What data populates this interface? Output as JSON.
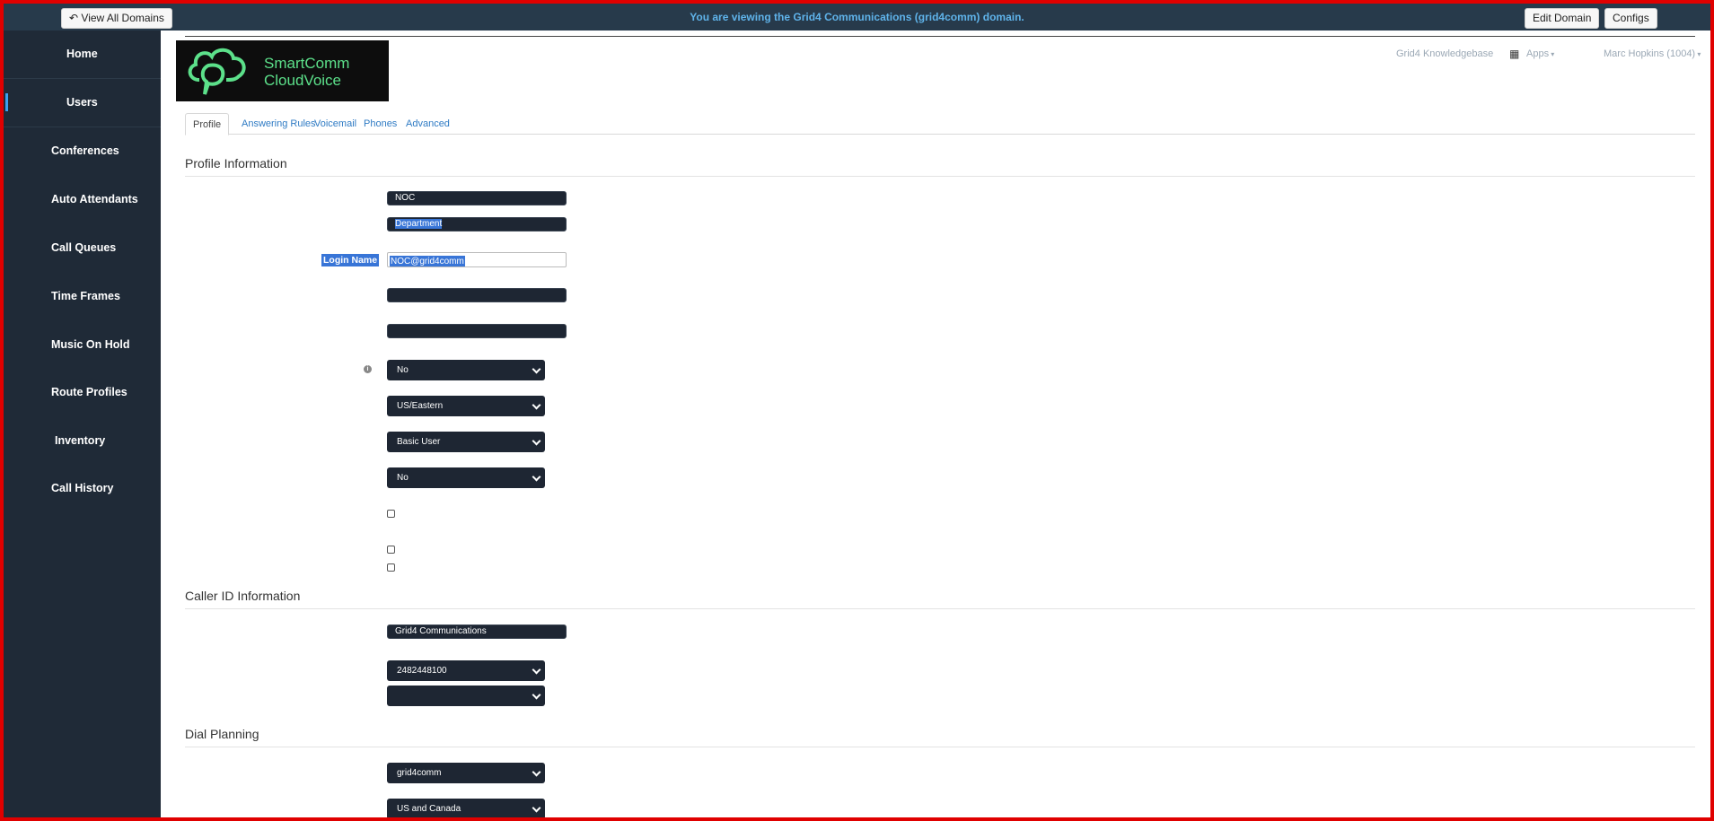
{
  "topbar": {
    "view_all_label": "View All Domains",
    "message": "You are viewing the Grid4 Communications (grid4comm) domain.",
    "edit_domain_label": "Edit Domain",
    "configs_label": "Configs"
  },
  "sidebar": {
    "items": [
      {
        "label": "Home"
      },
      {
        "label": "Users"
      },
      {
        "label": "Conferences"
      },
      {
        "label": "Auto Attendants"
      },
      {
        "label": "Call Queues"
      },
      {
        "label": "Time Frames"
      },
      {
        "label": "Music On Hold"
      },
      {
        "label": "Route Profiles"
      },
      {
        "label": "Inventory"
      },
      {
        "label": "Call History"
      }
    ]
  },
  "header": {
    "logo_line1": "SmartComm",
    "logo_line2": "CloudVoice",
    "knowledgebase": "Grid4 Knowledgebase",
    "apps": "Apps",
    "user": "Marc Hopkins (1004)"
  },
  "tabs": [
    "Profile",
    "Answering Rules",
    "Voicemail",
    "Phones",
    "Advanced"
  ],
  "profile": {
    "title": "Profile Information",
    "first_name": "NOC",
    "department": "Department",
    "login_label": "Login Name",
    "login_value": "NOC@grid4comm",
    "field4": "",
    "field5": "",
    "select1": "No",
    "timezone": "US/Eastern",
    "scope": "Basic User",
    "select4": "No"
  },
  "caller_id": {
    "title": "Caller ID Information",
    "name": "Grid4 Communications",
    "number": "2482448100",
    "number2": ""
  },
  "dial_planning": {
    "title": "Dial Planning",
    "dial_plan": "grid4comm",
    "dial_policy": "US and Canada"
  },
  "colors": {
    "topbar": "#273a4b",
    "sidebar": "#1f2a37",
    "accent": "#3aa0f0",
    "link": "#2f7bc4",
    "border_red": "#e00000"
  }
}
